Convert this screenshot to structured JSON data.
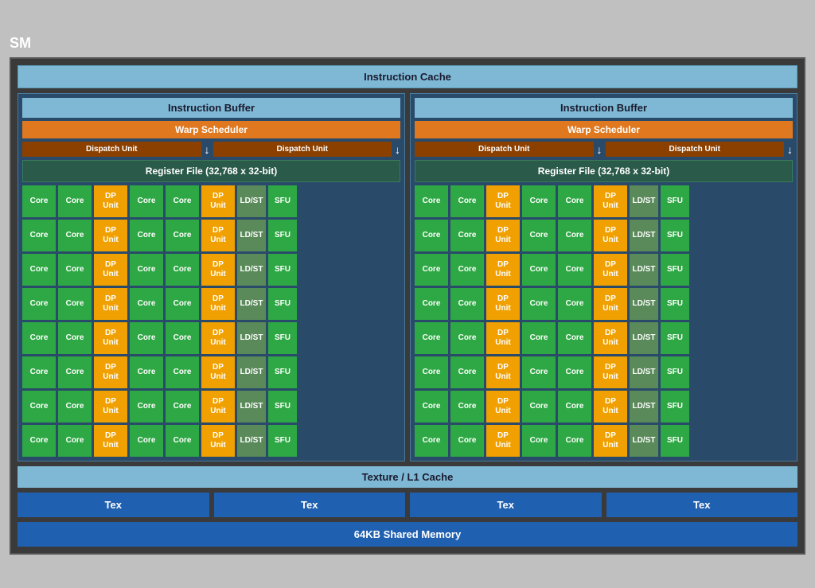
{
  "sm": {
    "label": "SM",
    "instruction_cache": "Instruction Cache",
    "texture_l1": "Texture / L1 Cache",
    "shared_memory": "64KB Shared Memory",
    "panels": [
      {
        "instruction_buffer": "Instruction Buffer",
        "warp_scheduler": "Warp Scheduler",
        "dispatch_unit_1": "Dispatch Unit",
        "dispatch_unit_2": "Dispatch Unit",
        "register_file": "Register File (32,768 x 32-bit)"
      },
      {
        "instruction_buffer": "Instruction Buffer",
        "warp_scheduler": "Warp Scheduler",
        "dispatch_unit_1": "Dispatch Unit",
        "dispatch_unit_2": "Dispatch Unit",
        "register_file": "Register File (32,768 x 32-bit)"
      }
    ],
    "core_label": "Core",
    "dp_unit_label": "DP\nUnit",
    "ldst_label": "LD/ST",
    "sfu_label": "SFU",
    "rows": 8,
    "tex_units": [
      "Tex",
      "Tex",
      "Tex",
      "Tex"
    ]
  }
}
